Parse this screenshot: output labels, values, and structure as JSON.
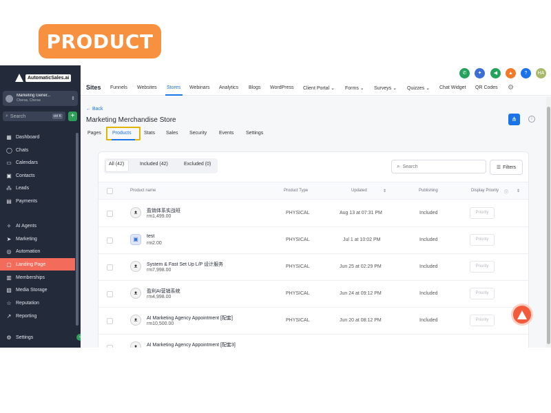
{
  "banner": {
    "label": "PRODUCT"
  },
  "sidebar": {
    "logo_text": "AutomaticSales.ai",
    "account": {
      "name": "Marketing Gener...",
      "location": "Cheras, Cheras"
    },
    "search": {
      "placeholder": "Search",
      "shortcut": "ctrl K"
    },
    "items": [
      {
        "label": "Dashboard",
        "icon": "grid-icon"
      },
      {
        "label": "Chats",
        "icon": "chat-icon"
      },
      {
        "label": "Calendars",
        "icon": "calendar-icon"
      },
      {
        "label": "Contacts",
        "icon": "contacts-icon"
      },
      {
        "label": "Leads",
        "icon": "leads-icon"
      },
      {
        "label": "Payments",
        "icon": "payments-icon"
      },
      {
        "label": "AI Agents",
        "icon": "sparkle-icon"
      },
      {
        "label": "Marketing",
        "icon": "send-icon"
      },
      {
        "label": "Automation",
        "icon": "automation-icon"
      },
      {
        "label": "Landing Page",
        "icon": "landing-page-icon",
        "active": true
      },
      {
        "label": "Memberships",
        "icon": "memberships-icon"
      },
      {
        "label": "Media Storage",
        "icon": "media-icon"
      },
      {
        "label": "Reputation",
        "icon": "star-icon"
      },
      {
        "label": "Reporting",
        "icon": "chart-icon"
      }
    ],
    "settings_label": "Settings"
  },
  "topnav": {
    "title": "Sites",
    "links": [
      "Funnels",
      "Websites",
      "Stores",
      "Webinars",
      "Analytics",
      "Blogs",
      "WordPress",
      "Client Portal ⌄",
      "Forms ⌄",
      "Surveys ⌄",
      "Quizzes ⌄",
      "Chat Widget",
      "QR Codes"
    ],
    "active_link": "Stores",
    "user_initials": "HA"
  },
  "content": {
    "back_label": "← Back",
    "store_title": "Marketing Merchandise Store",
    "tabs": [
      "Pages",
      "Products",
      "Stats",
      "Sales",
      "Security",
      "Events",
      "Settings"
    ],
    "active_tab": "Products"
  },
  "filters": {
    "all": "All (42)",
    "included": "Included (42)",
    "excluded": "Excluded (0)",
    "search_placeholder": "Search",
    "filters_label": "Filters"
  },
  "table": {
    "headers": {
      "name": "Product name",
      "type": "Product Type",
      "updated": "Updated",
      "publishing": "Publishing",
      "priority": "Display Priority"
    },
    "rows": [
      {
        "name": "盈销体系实战班",
        "price": "rm1,499.00",
        "type": "PHYSICAL",
        "updated": "Aug 13 at 07:31 PM",
        "publishing": "Included",
        "priority": "Priority"
      },
      {
        "name": "test",
        "price": "rm2.00",
        "type": "PHYSICAL",
        "updated": "Jul 1 at 10:02 PM",
        "publishing": "Included",
        "priority": "Priority"
      },
      {
        "name": "System & Fast Set Up L/P 设计服务",
        "price": "rm7,998.00",
        "type": "PHYSICAL",
        "updated": "Jun 25 at 02:29 PM",
        "publishing": "Included",
        "priority": "Priority"
      },
      {
        "name": "盈利AI营销系统",
        "price": "rm4,998.00",
        "type": "PHYSICAL",
        "updated": "Jun 24 at 09:12 PM",
        "publishing": "Included",
        "priority": "Priority"
      },
      {
        "name": "AI Marketing Agency Appointment [配套]",
        "price": "rm10,500.00",
        "type": "PHYSICAL",
        "updated": "Jun 20 at 08:12 PM",
        "publishing": "Included",
        "priority": "Priority"
      },
      {
        "name": "AI Marketing Agency Appointment [配套3]",
        "price": "",
        "type": "",
        "updated": "",
        "publishing": "",
        "priority": ""
      }
    ]
  }
}
